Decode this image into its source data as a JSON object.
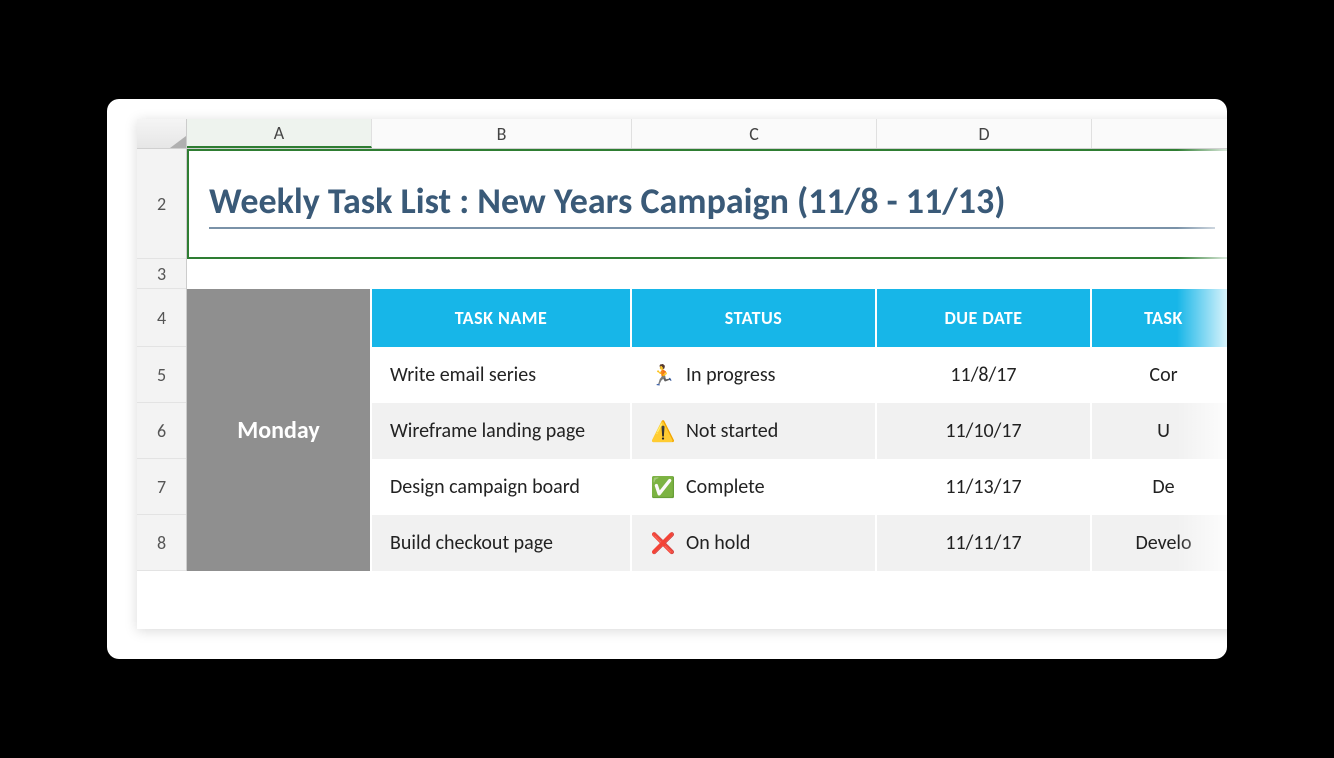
{
  "columns": {
    "a": "A",
    "b": "B",
    "c": "C",
    "d": "D"
  },
  "row_numbers": [
    "2",
    "3",
    "4",
    "5",
    "6",
    "7",
    "8"
  ],
  "title": "Weekly Task List : New Years Campaign (11/8 - 11/13)",
  "day_label": "Monday",
  "headers": {
    "task_name": "TASK NAME",
    "status": "STATUS",
    "due_date": "DUE DATE",
    "task_owner": "TASK"
  },
  "status_icons": {
    "in_progress": "🏃",
    "not_started": "⚠️",
    "complete": "✅",
    "on_hold": "❌"
  },
  "rows": [
    {
      "task": "Write email series",
      "status_key": "in_progress",
      "status": "In progress",
      "due": "11/8/17",
      "owner": "Cor"
    },
    {
      "task": "Wireframe landing page",
      "status_key": "not_started",
      "status": "Not started",
      "due": "11/10/17",
      "owner": "U"
    },
    {
      "task": "Design campaign board",
      "status_key": "complete",
      "status": "Complete",
      "due": "11/13/17",
      "owner": "De"
    },
    {
      "task": "Build checkout page",
      "status_key": "on_hold",
      "status": "On hold",
      "due": "11/11/17",
      "owner": "Develo"
    }
  ]
}
